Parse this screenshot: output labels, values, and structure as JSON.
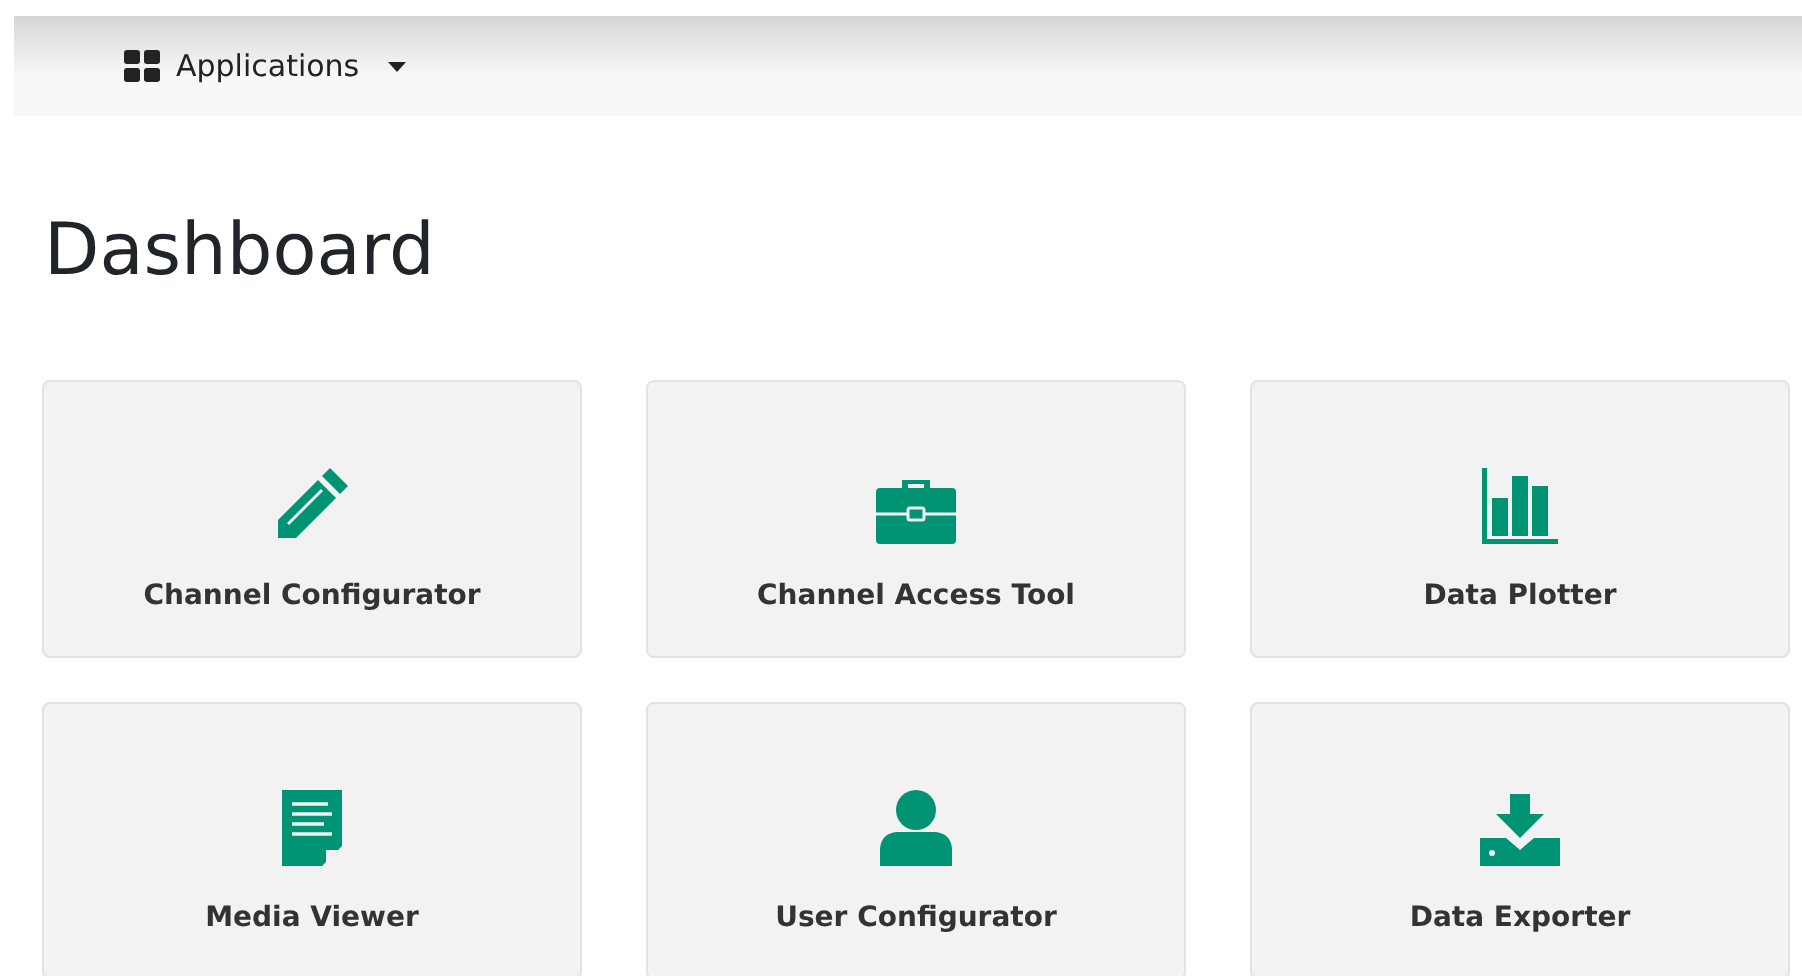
{
  "navbar": {
    "menu": {
      "label": "Applications"
    }
  },
  "heading": "Dashboard",
  "tiles": [
    {
      "label": "Channel Configurator",
      "kind": "pencil"
    },
    {
      "label": "Channel Access Tool",
      "kind": "briefcase"
    },
    {
      "label": "Data Plotter",
      "kind": "chart"
    },
    {
      "label": "Media Viewer",
      "kind": "document"
    },
    {
      "label": "User Configurator",
      "kind": "user"
    },
    {
      "label": "Data Exporter",
      "kind": "download"
    }
  ]
}
